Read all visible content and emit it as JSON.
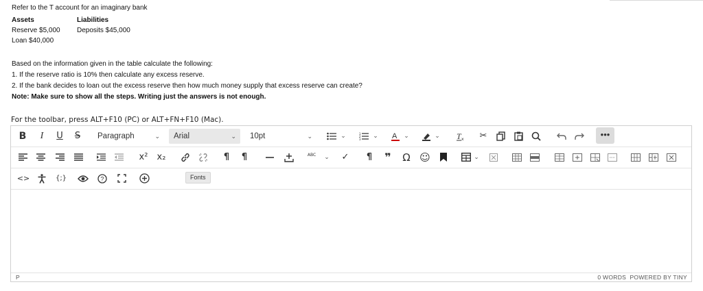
{
  "question": {
    "intro": "Refer to the T account for an imaginary bank",
    "assets_header": "Assets",
    "liabilities_header": "Liabilities",
    "reserve": "Reserve $5,000",
    "deposits": "Deposits $45,000",
    "loan": "Loan $40,000",
    "based_on": "Based on the information given in the table calculate the following:",
    "q1": "1. If the reserve ratio is 10% then calculate any excess reserve.",
    "q2": "2. If the bank decides to loan out the excess reserve then how much money supply that excess reserve can create?",
    "note": "Note: Make sure to show all the steps. Writing just the answers is not enough."
  },
  "editor": {
    "hint": "For the toolbar, press ALT+F10 (PC) or ALT+FN+F10 (Mac).",
    "block_format": "Paragraph",
    "font_family": "Arial",
    "font_size": "10pt",
    "more_label": "•••",
    "tooltip": "Fonts",
    "path": "P",
    "word_count": "0 WORDS",
    "powered_by": "POWERED BY TINY"
  },
  "icons": {
    "bold": "B",
    "italic": "I",
    "underline": "U",
    "strike": "S",
    "superscript": "x²",
    "subscript": "x₂",
    "code": "<>",
    "braces": "{;}",
    "ltr": "¶",
    "rtl": "¶",
    "pilcrow": "¶",
    "quote": "❞",
    "omega": "Ω",
    "emoji": "☺",
    "spell": "ABC",
    "check": "✓"
  }
}
